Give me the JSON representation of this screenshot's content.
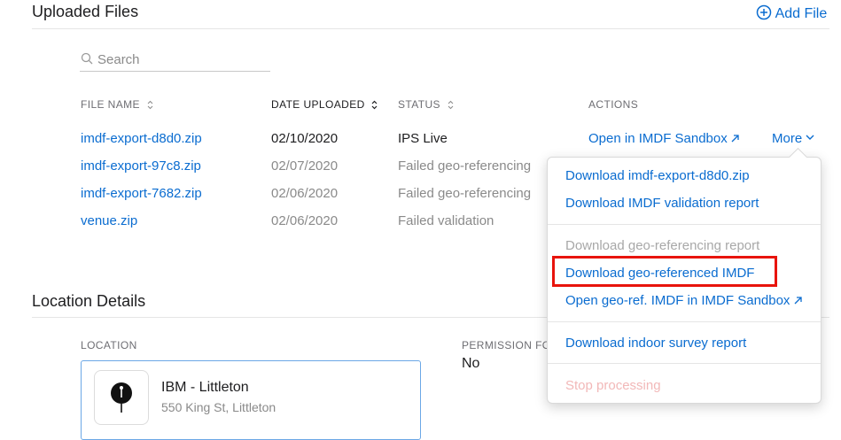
{
  "uploaded": {
    "title": "Uploaded Files",
    "add_file_label": "Add File",
    "search_placeholder": "Search",
    "columns": [
      "FILE NAME",
      "DATE UPLOADED",
      "STATUS",
      "ACTIONS"
    ],
    "rows": [
      {
        "name": "imdf-export-d8d0.zip",
        "date": "02/10/2020",
        "status": "IPS Live",
        "action": "Open in IMDF Sandbox",
        "more": "More"
      },
      {
        "name": "imdf-export-97c8.zip",
        "date": "02/07/2020",
        "status": "Failed geo-referencing"
      },
      {
        "name": "imdf-export-7682.zip",
        "date": "02/06/2020",
        "status": "Failed geo-referencing"
      },
      {
        "name": "venue.zip",
        "date": "02/06/2020",
        "status": "Failed validation"
      }
    ]
  },
  "dropdown": {
    "items": [
      "Download imdf-export-d8d0.zip",
      "Download IMDF validation report",
      "Download geo-referencing report",
      "Download geo-referenced IMDF",
      "Open geo-ref. IMDF in IMDF Sandbox",
      "Download indoor survey report",
      "Stop processing"
    ]
  },
  "location": {
    "title": "Location Details",
    "location_label": "LOCATION",
    "permission_label": "PERMISSION FO",
    "permission_value": "No",
    "name": "IBM - Littleton",
    "address": "550 King St, Littleton"
  },
  "colors": {
    "link": "#0a6cd0",
    "highlight": "#e8140c",
    "disabled": "#a8a8a8"
  }
}
